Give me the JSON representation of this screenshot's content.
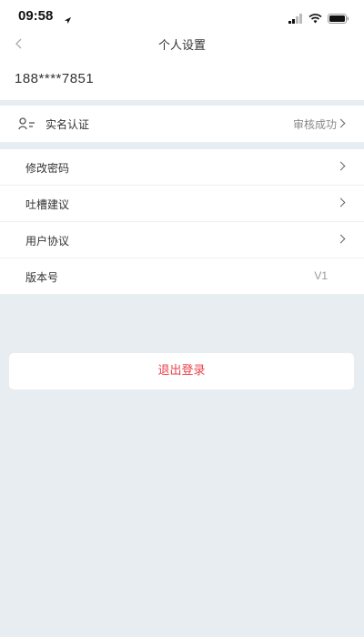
{
  "status_bar": {
    "time": "09:58"
  },
  "nav": {
    "title": "个人设置"
  },
  "account": {
    "phone": "188****7851"
  },
  "verification": {
    "label": "实名认证",
    "status": "审核成功"
  },
  "settings": {
    "items": [
      {
        "label": "修改密码",
        "value": ""
      },
      {
        "label": "吐槽建议",
        "value": ""
      },
      {
        "label": "用户协议",
        "value": ""
      },
      {
        "label": "版本号",
        "value": "V1"
      }
    ]
  },
  "logout": {
    "label": "退出登录"
  },
  "colors": {
    "accent_red": "#e8424b",
    "background": "#e8edf2"
  }
}
